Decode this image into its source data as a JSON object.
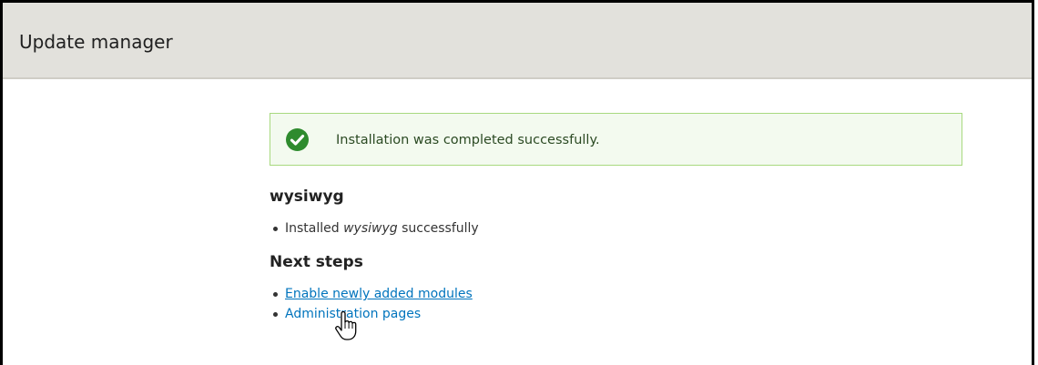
{
  "header": {
    "title": "Update manager"
  },
  "message": {
    "status": "success",
    "icon": "check-circle-icon",
    "text": "Installation was completed successfully.",
    "colors": {
      "background": "#f3faef",
      "border": "#a8d97f",
      "icon": "#2e8b2e"
    }
  },
  "project": {
    "title": "wysiwyg",
    "items": [
      {
        "prefix": "Installed ",
        "emphasis": "wysiwyg",
        "suffix": " successfully"
      }
    ]
  },
  "next_steps": {
    "title": "Next steps",
    "links": [
      {
        "label": "Enable newly added modules"
      },
      {
        "label": "Administration pages"
      }
    ]
  },
  "cursor": {
    "icon": "hand-pointer-icon"
  }
}
